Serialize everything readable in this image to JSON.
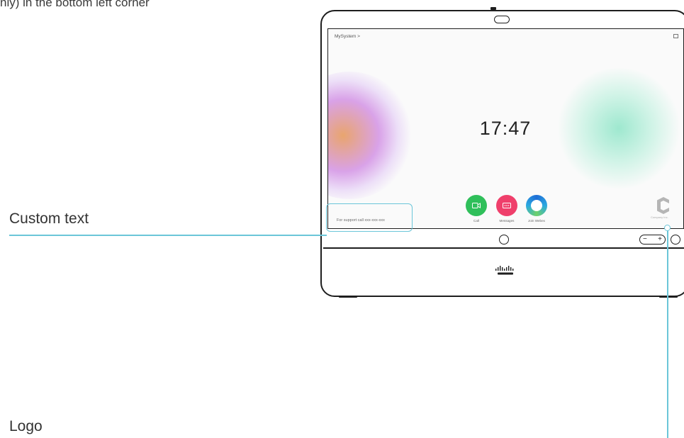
{
  "intro_text": "nly) in the bottom left corner",
  "callouts": {
    "custom_text": "Custom text",
    "logo": "Logo"
  },
  "screen": {
    "breadcrumb": "MySystem >",
    "clock": "17:47",
    "apps": [
      {
        "label": "Call",
        "color": "#2fbf5a",
        "icon": "video-camera-icon"
      },
      {
        "label": "Messages",
        "color": "#ef3f6b",
        "icon": "messages-icon"
      },
      {
        "label": "Join Webex",
        "color": "#1f6dd6",
        "icon": "webex-icon"
      }
    ],
    "support_text": "For support call xxx-xxx-xxx",
    "logo_caption": "Company Inc."
  },
  "accent_color": "#6bc6d9",
  "volume_symbols": {
    "minus": "−",
    "plus": "+"
  }
}
